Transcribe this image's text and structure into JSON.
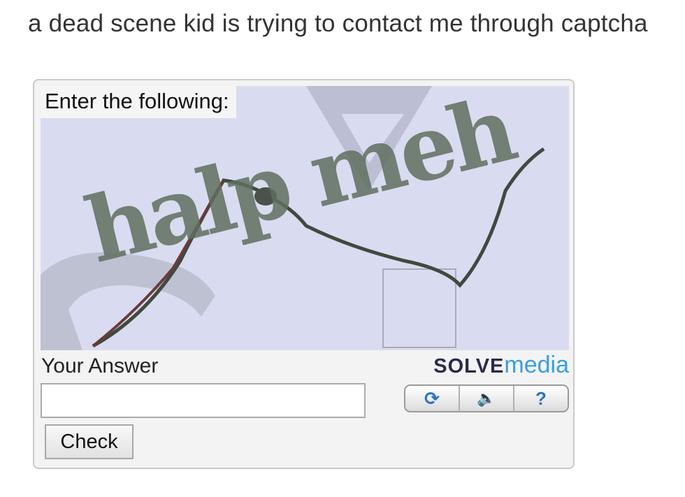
{
  "post": {
    "caption": "a dead scene kid is trying to contact me through captcha"
  },
  "captcha": {
    "instruction": "Enter the following:",
    "distorted_text": "halp meh",
    "answer_label": "Your Answer",
    "answer_value": "",
    "brand_part1": "SOLVE",
    "brand_part2": "media",
    "check_label": "Check",
    "controls": [
      {
        "name": "refresh",
        "glyph": "⟳"
      },
      {
        "name": "audio",
        "glyph": "🔈"
      },
      {
        "name": "help",
        "glyph": "?"
      }
    ],
    "colors": {
      "puzzle_background": "#d9dcf0",
      "brand_accent": "#3a9fdc",
      "control_icon": "#2b73c4"
    }
  }
}
